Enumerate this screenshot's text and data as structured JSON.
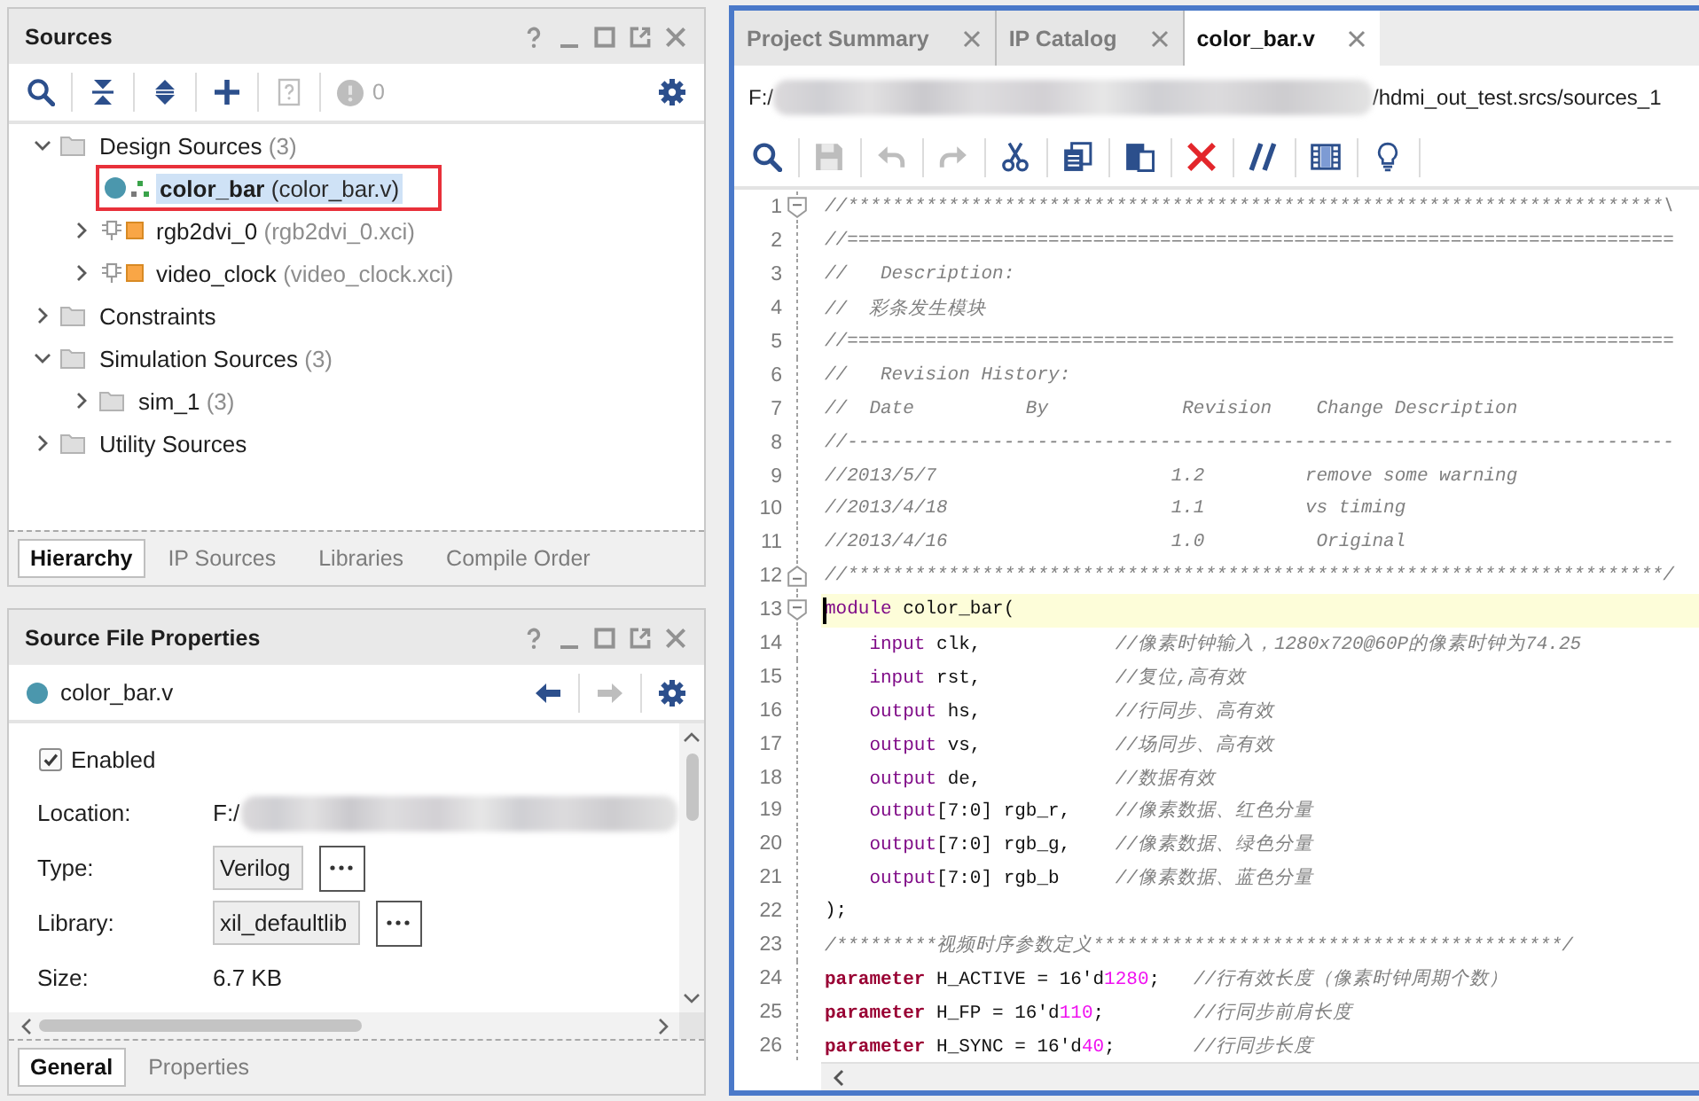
{
  "sources": {
    "title": "Sources",
    "toolbar": [
      {
        "kind": "search",
        "disabled": false
      },
      {
        "kind": "collapse-all",
        "disabled": false
      },
      {
        "kind": "expand-all",
        "disabled": false
      },
      {
        "kind": "add",
        "disabled": false
      },
      {
        "kind": "help-page",
        "disabled": true
      },
      {
        "kind": "messages",
        "disabled": true,
        "count": "0"
      },
      {
        "kind": "settings",
        "disabled": false
      }
    ],
    "tree": [
      {
        "kind": "folder",
        "label": "Design Sources",
        "detail": "(3)",
        "expanded": true,
        "selected": false,
        "outlined": false,
        "children": [
          {
            "kind": "top-module",
            "label": "color_bar",
            "detail": "(color_bar.v)",
            "selected": true,
            "outlined": true
          },
          {
            "kind": "ip",
            "label": "rgb2dvi_0",
            "detail": "(rgb2dvi_0.xci)",
            "expanded": false,
            "selected": false,
            "outlined": false
          },
          {
            "kind": "ip",
            "label": "video_clock",
            "detail": "(video_clock.xci)",
            "expanded": false,
            "selected": false,
            "outlined": false
          }
        ]
      },
      {
        "kind": "folder",
        "label": "Constraints",
        "expanded": false,
        "selected": false,
        "outlined": false
      },
      {
        "kind": "folder",
        "label": "Simulation Sources",
        "detail": "(3)",
        "expanded": true,
        "selected": false,
        "outlined": false,
        "children": [
          {
            "kind": "folder",
            "label": "sim_1",
            "detail": "(3)",
            "expanded": false,
            "selected": false,
            "outlined": false
          }
        ]
      },
      {
        "kind": "folder",
        "label": "Utility Sources",
        "expanded": false,
        "selected": false,
        "outlined": false
      }
    ],
    "tabs": [
      {
        "label": "Hierarchy",
        "selected": true
      },
      {
        "label": "IP Sources",
        "selected": false
      },
      {
        "label": "Libraries",
        "selected": false
      },
      {
        "label": "Compile Order",
        "selected": false
      }
    ]
  },
  "properties": {
    "title": "Source File Properties",
    "file": "color_bar.v",
    "nav": [
      {
        "kind": "back",
        "disabled": false
      },
      {
        "kind": "forward",
        "disabled": true
      },
      {
        "kind": "settings",
        "disabled": false
      }
    ],
    "enabled": {
      "label": "Enabled",
      "checked": true
    },
    "fields": [
      {
        "kind": "text",
        "label": "Location:",
        "value": "F:/",
        "redacted": true
      },
      {
        "kind": "choice",
        "label": "Type:",
        "value": "Verilog",
        "redacted": false
      },
      {
        "kind": "choice",
        "label": "Library:",
        "value": "xil_defaultlib",
        "redacted": false
      },
      {
        "kind": "text",
        "label": "Size:",
        "value": "6.7 KB",
        "redacted": false
      }
    ],
    "tabs": [
      {
        "label": "General",
        "selected": true
      },
      {
        "label": "Properties",
        "selected": false
      }
    ]
  },
  "editor": {
    "tabs": [
      {
        "label": "Project Summary",
        "selected": false
      },
      {
        "label": "IP Catalog",
        "selected": false
      },
      {
        "label": "color_bar.v",
        "selected": true
      }
    ],
    "path": {
      "prefix": "F:/",
      "redacted": true,
      "suffix": "/hdmi_out_test.srcs/sources_1"
    },
    "toolbar": [
      {
        "kind": "search",
        "disabled": false
      },
      {
        "kind": "save",
        "disabled": true
      },
      {
        "kind": "undo",
        "disabled": true
      },
      {
        "kind": "redo",
        "disabled": true
      },
      {
        "kind": "cut",
        "disabled": false
      },
      {
        "kind": "copy",
        "disabled": false
      },
      {
        "kind": "paste",
        "disabled": false
      },
      {
        "kind": "delete",
        "disabled": false
      },
      {
        "kind": "comment",
        "disabled": false
      },
      {
        "kind": "columns",
        "disabled": false
      },
      {
        "kind": "hint",
        "disabled": false
      }
    ],
    "lines": [
      {
        "number": "1",
        "fold_start": true,
        "fold_end": false,
        "current": false,
        "tokens": [
          {
            "kind": "comment",
            "text": "//*************************************************************************\\"
          }
        ]
      },
      {
        "number": "2",
        "fold_start": false,
        "fold_end": false,
        "current": false,
        "tokens": [
          {
            "kind": "comment",
            "text": "//=========================================================================="
          }
        ]
      },
      {
        "number": "3",
        "fold_start": false,
        "fold_end": false,
        "current": false,
        "tokens": [
          {
            "kind": "comment",
            "text": "//   Description:"
          }
        ]
      },
      {
        "number": "4",
        "fold_start": false,
        "fold_end": false,
        "current": false,
        "tokens": [
          {
            "kind": "comment",
            "text": "//  彩条发生模块"
          }
        ]
      },
      {
        "number": "5",
        "fold_start": false,
        "fold_end": false,
        "current": false,
        "tokens": [
          {
            "kind": "comment",
            "text": "//=========================================================================="
          }
        ]
      },
      {
        "number": "6",
        "fold_start": false,
        "fold_end": false,
        "current": false,
        "tokens": [
          {
            "kind": "comment",
            "text": "//   Revision History:"
          }
        ]
      },
      {
        "number": "7",
        "fold_start": false,
        "fold_end": false,
        "current": false,
        "tokens": [
          {
            "kind": "comment",
            "text": "//  Date          By            Revision    Change Description"
          }
        ]
      },
      {
        "number": "8",
        "fold_start": false,
        "fold_end": false,
        "current": false,
        "tokens": [
          {
            "kind": "comment",
            "text": "//--------------------------------------------------------------------------"
          }
        ]
      },
      {
        "number": "9",
        "fold_start": false,
        "fold_end": false,
        "current": false,
        "tokens": [
          {
            "kind": "comment",
            "text": "//2013/5/7                     1.2         remove some warning"
          }
        ]
      },
      {
        "number": "10",
        "fold_start": false,
        "fold_end": false,
        "current": false,
        "tokens": [
          {
            "kind": "comment",
            "text": "//2013/4/18                    1.1         vs timing"
          }
        ]
      },
      {
        "number": "11",
        "fold_start": false,
        "fold_end": false,
        "current": false,
        "tokens": [
          {
            "kind": "comment",
            "text": "//2013/4/16                    1.0          Original"
          }
        ]
      },
      {
        "number": "12",
        "fold_start": false,
        "fold_end": true,
        "current": false,
        "tokens": [
          {
            "kind": "comment",
            "text": "//*************************************************************************/"
          }
        ]
      },
      {
        "number": "13",
        "fold_start": true,
        "fold_end": false,
        "current": true,
        "tokens": [
          {
            "kind": "keyword",
            "text": "module"
          },
          {
            "kind": "text",
            "text": " color_bar("
          }
        ]
      },
      {
        "number": "14",
        "fold_start": false,
        "fold_end": false,
        "current": false,
        "tokens": [
          {
            "kind": "keyword",
            "text": "    input"
          },
          {
            "kind": "text",
            "text": " clk,            "
          },
          {
            "kind": "comment",
            "text": "//像素时钟输入，1280x720@60P的像素时钟为74.25"
          }
        ]
      },
      {
        "number": "15",
        "fold_start": false,
        "fold_end": false,
        "current": false,
        "tokens": [
          {
            "kind": "keyword",
            "text": "    input"
          },
          {
            "kind": "text",
            "text": " rst,            "
          },
          {
            "kind": "comment",
            "text": "//复位,高有效"
          }
        ]
      },
      {
        "number": "16",
        "fold_start": false,
        "fold_end": false,
        "current": false,
        "tokens": [
          {
            "kind": "keyword",
            "text": "    output"
          },
          {
            "kind": "text",
            "text": " hs,            "
          },
          {
            "kind": "comment",
            "text": "//行同步、高有效"
          }
        ]
      },
      {
        "number": "17",
        "fold_start": false,
        "fold_end": false,
        "current": false,
        "tokens": [
          {
            "kind": "keyword",
            "text": "    output"
          },
          {
            "kind": "text",
            "text": " vs,            "
          },
          {
            "kind": "comment",
            "text": "//场同步、高有效"
          }
        ]
      },
      {
        "number": "18",
        "fold_start": false,
        "fold_end": false,
        "current": false,
        "tokens": [
          {
            "kind": "keyword",
            "text": "    output"
          },
          {
            "kind": "text",
            "text": " de,            "
          },
          {
            "kind": "comment",
            "text": "//数据有效"
          }
        ]
      },
      {
        "number": "19",
        "fold_start": false,
        "fold_end": false,
        "current": false,
        "tokens": [
          {
            "kind": "keyword",
            "text": "    output"
          },
          {
            "kind": "text",
            "text": "[7:0] rgb_r,    "
          },
          {
            "kind": "comment",
            "text": "//像素数据、红色分量"
          }
        ]
      },
      {
        "number": "20",
        "fold_start": false,
        "fold_end": false,
        "current": false,
        "tokens": [
          {
            "kind": "keyword",
            "text": "    output"
          },
          {
            "kind": "text",
            "text": "[7:0] rgb_g,    "
          },
          {
            "kind": "comment",
            "text": "//像素数据、绿色分量"
          }
        ]
      },
      {
        "number": "21",
        "fold_start": false,
        "fold_end": false,
        "current": false,
        "tokens": [
          {
            "kind": "keyword",
            "text": "    output"
          },
          {
            "kind": "text",
            "text": "[7:0] rgb_b     "
          },
          {
            "kind": "comment",
            "text": "//像素数据、蓝色分量"
          }
        ]
      },
      {
        "number": "22",
        "fold_start": false,
        "fold_end": false,
        "current": false,
        "tokens": [
          {
            "kind": "text",
            "text": ");"
          }
        ]
      },
      {
        "number": "23",
        "fold_start": false,
        "fold_end": false,
        "current": false,
        "tokens": [
          {
            "kind": "comment",
            "text": "/*********视频时序参数定义******************************************/"
          }
        ]
      },
      {
        "number": "24",
        "fold_start": false,
        "fold_end": false,
        "current": false,
        "tokens": [
          {
            "kind": "param",
            "text": "parameter"
          },
          {
            "kind": "text",
            "text": " H_ACTIVE = 16'd"
          },
          {
            "kind": "number",
            "text": "1280"
          },
          {
            "kind": "text",
            "text": ";   "
          },
          {
            "kind": "comment",
            "text": "//行有效长度（像素时钟周期个数）"
          }
        ]
      },
      {
        "number": "25",
        "fold_start": false,
        "fold_end": false,
        "current": false,
        "tokens": [
          {
            "kind": "param",
            "text": "parameter"
          },
          {
            "kind": "text",
            "text": " H_FP = 16'd"
          },
          {
            "kind": "number",
            "text": "110"
          },
          {
            "kind": "text",
            "text": ";        "
          },
          {
            "kind": "comment",
            "text": "//行同步前肩长度"
          }
        ]
      },
      {
        "number": "26",
        "fold_start": false,
        "fold_end": false,
        "current": false,
        "tokens": [
          {
            "kind": "param",
            "text": "parameter"
          },
          {
            "kind": "text",
            "text": " H_SYNC = 16'd"
          },
          {
            "kind": "number",
            "text": "40"
          },
          {
            "kind": "text",
            "text": ";       "
          },
          {
            "kind": "comment",
            "text": "//行同步长度"
          }
        ]
      }
    ]
  }
}
